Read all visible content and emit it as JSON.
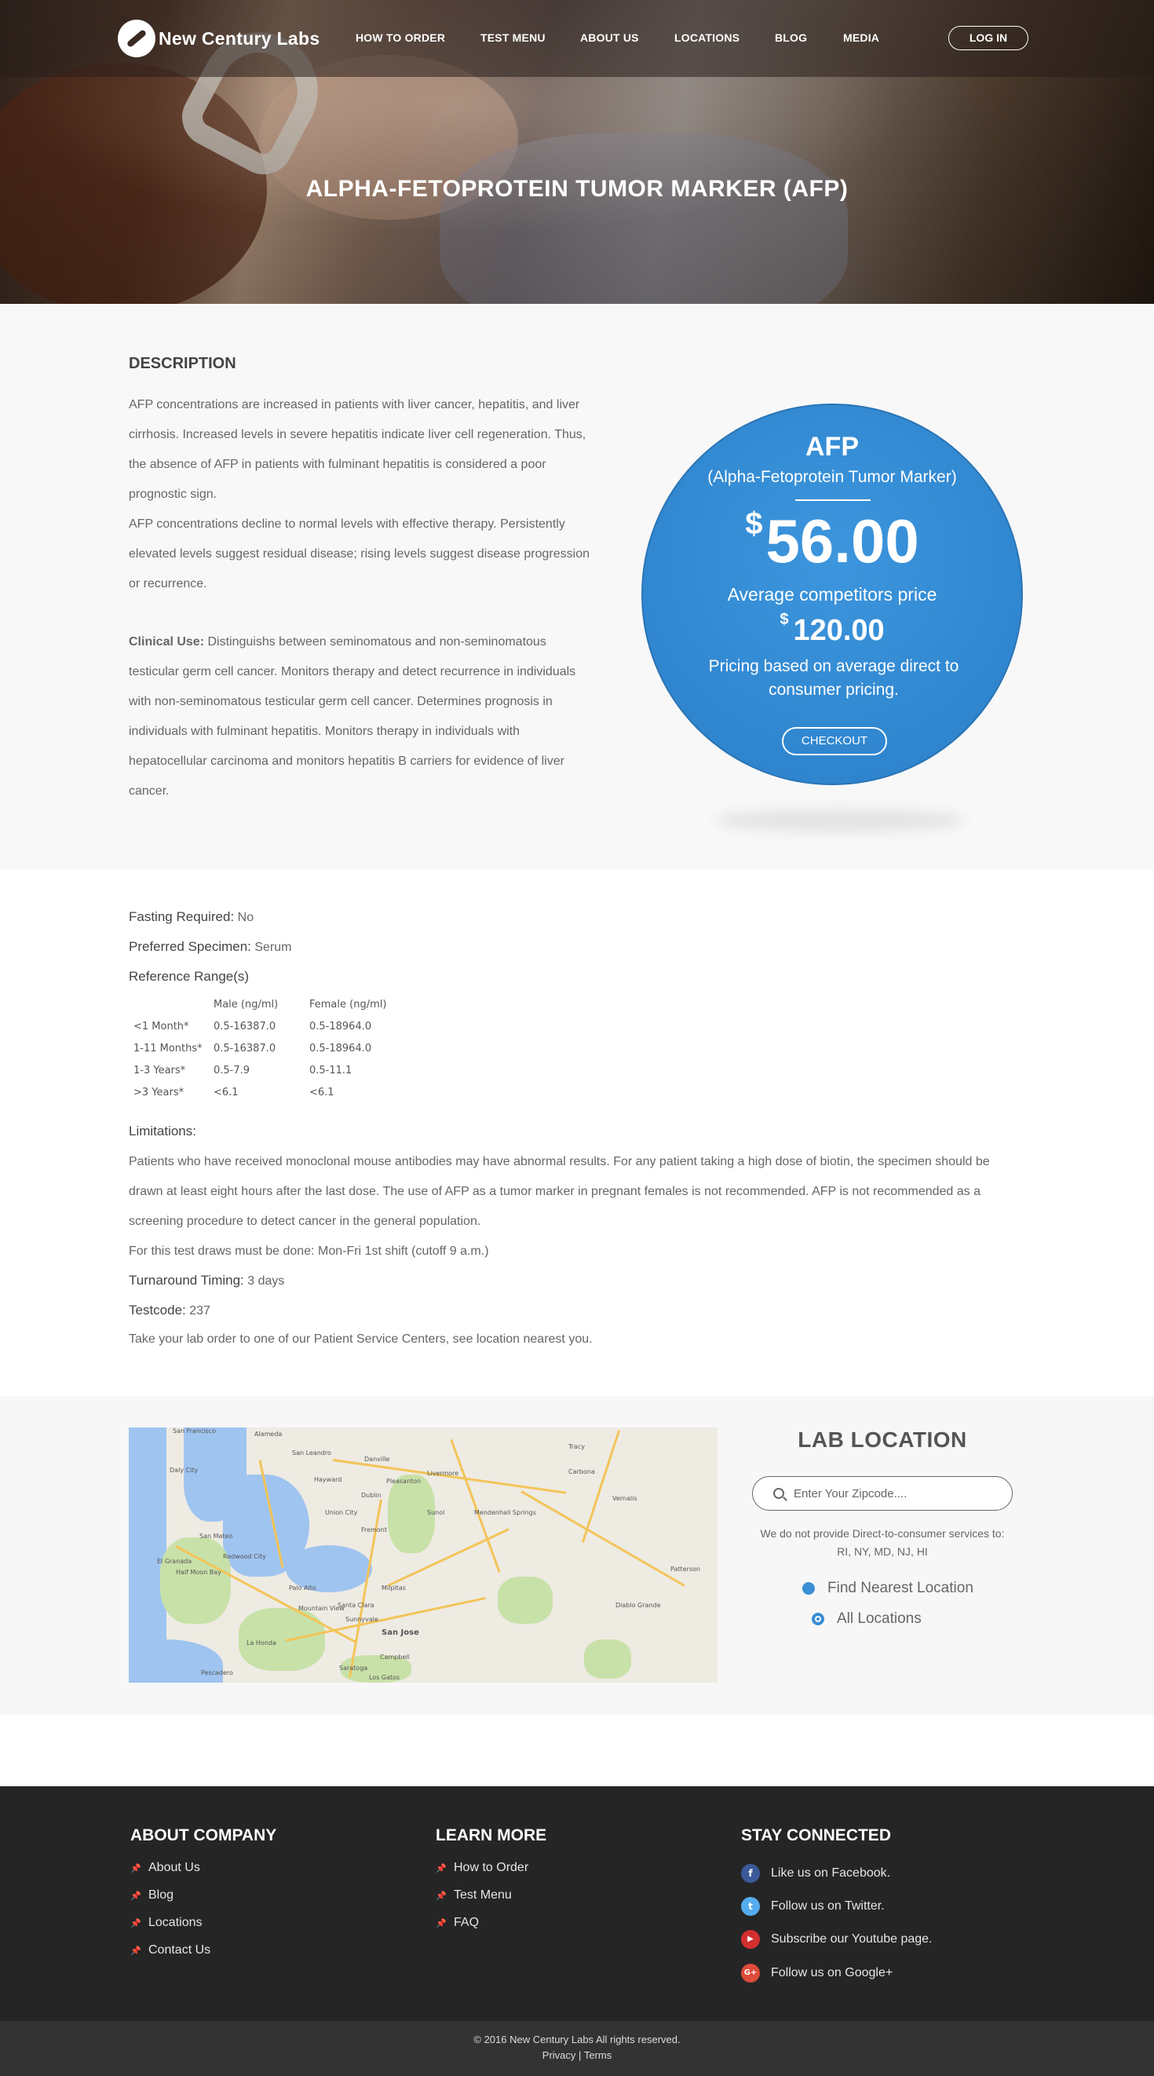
{
  "nav": {
    "logo_text": "New Century Labs",
    "links": [
      "HOW TO ORDER",
      "TEST MENU",
      "ABOUT US",
      "LOCATIONS",
      "BLOG",
      "MEDIA"
    ],
    "login_label": "LOG IN"
  },
  "hero": {
    "title": "ALPHA-FETOPROTEIN TUMOR MARKER (AFP)"
  },
  "description": {
    "heading": "DESCRIPTION",
    "para1": "AFP concentrations are increased in patients with liver cancer, hepatitis, and liver cirrhosis. Increased levels in severe hepatitis indicate liver cell regeneration. Thus, the absence of AFP in patients with fulminant hepatitis is considered a poor prognostic sign.",
    "para2": "AFP concentrations decline to normal levels with effective therapy. Persistently elevated levels suggest residual disease; rising levels suggest disease progression or recurrence.",
    "clinical_label": "Clinical Use:",
    "clinical_text": " Distinguishs between seminomatous and non-seminomatous testicular germ cell cancer. Monitors therapy and detect recurrence in individuals with non-seminomatous testicular germ cell cancer. Determines prognosis in individuals with fulminant hepatitis. Monitors therapy in individuals with hepatocellular carcinoma and monitors hepatitis B carriers for evidence of liver cancer."
  },
  "price_card": {
    "title": "AFP",
    "subtitle": "(Alpha-Fetoprotein Tumor Marker)",
    "currency": "$",
    "price": "56.00",
    "avg_label": "Average competitors price",
    "avg_price": "120.00",
    "note": "Pricing based on average direct to consumer pricing.",
    "checkout_label": "CHECKOUT"
  },
  "details": {
    "fasting_label": "Fasting Required:",
    "fasting_value": " No",
    "specimen_label": "Preferred Specimen:",
    "specimen_value": " Serum",
    "ref_label": "Reference Range(s)",
    "ref_headers": [
      "",
      "Male (ng/ml)",
      "Female (ng/ml)"
    ],
    "ref_rows": [
      [
        "<1 Month*",
        "0.5-16387.0",
        "0.5-18964.0"
      ],
      [
        "1-11 Months*",
        "0.5-16387.0",
        "0.5-18964.0"
      ],
      [
        "1-3 Years*",
        "0.5-7.9",
        "0.5-11.1"
      ],
      [
        ">3 Years*",
        "<6.1",
        "<6.1"
      ]
    ],
    "limitations_label": "Limitations:",
    "limitations_text": "Patients who have received monoclonal mouse antibodies may have abnormal results. For any patient taking a high dose of biotin, the specimen should be drawn at least eight hours after the last dose. The use of AFP as a tumor marker in pregnant females is not recommended. AFP is not recommended as a screening procedure to detect cancer in the general population.",
    "draws_text": "For this test draws must be done: Mon-Fri 1st shift (cutoff 9 a.m.)",
    "turnaround_label": "Turnaround Timing:",
    "turnaround_value": " 3 days",
    "testcode_label": "Testcode:",
    "testcode_value": " 237",
    "take_text": "Take your lab order to one of our Patient Service Centers, see location nearest you."
  },
  "lab": {
    "title": "LAB LOCATION",
    "zip_placeholder": "Enter Your Zipcode....",
    "note": "We do not provide Direct-to-consumer services to: RI, NY, MD, NJ, HI",
    "find_label": "Find Nearest Location",
    "all_label": "All Locations",
    "map_labels": [
      "San Francisco",
      "Alameda",
      "San Leandro",
      "Hayward",
      "Union City",
      "Fremont",
      "San Mateo",
      "Palo Alto",
      "Sunnyvale",
      "San Jose",
      "Milpitas",
      "Pleasanton",
      "Livermore",
      "Tracy",
      "Redwood City",
      "Daly City",
      "Half Moon Bay",
      "Campbell",
      "Saratoga",
      "Mountain View",
      "Santa Clara",
      "Danville",
      "Dublin",
      "Patterson",
      "Diablo Grande",
      "Mendenhall Springs",
      "Sunol",
      "Pescadero",
      "La Honda",
      "Los Gatos",
      "El Granada",
      "Vernalis",
      "Carbona"
    ]
  },
  "footer": {
    "about_title": "ABOUT COMPANY",
    "about_items": [
      "About Us",
      "Blog",
      "Locations",
      "Contact Us"
    ],
    "learn_title": "LEARN MORE",
    "learn_items": [
      "How to Order",
      "Test Menu",
      "FAQ"
    ],
    "stay_title": "STAY CONNECTED",
    "social_items": [
      {
        "label": "Like us on Facebook.",
        "icon": "facebook-icon",
        "glyph": "f",
        "color": "#3b5998"
      },
      {
        "label": "Follow us on Twitter.",
        "icon": "twitter-icon",
        "glyph": "t",
        "color": "#55acee"
      },
      {
        "label": "Subscribe our Youtube page.",
        "icon": "youtube-icon",
        "glyph": "▶",
        "color": "#d32f2f"
      },
      {
        "label": "Follow us on Google+",
        "icon": "google-plus-icon",
        "glyph": "G+",
        "color": "#dd4b39"
      }
    ],
    "copyright": "© 2016 New Century Labs All rights reserved.",
    "privacy": "Privacy",
    "separator": "|",
    "terms": "Terms"
  }
}
